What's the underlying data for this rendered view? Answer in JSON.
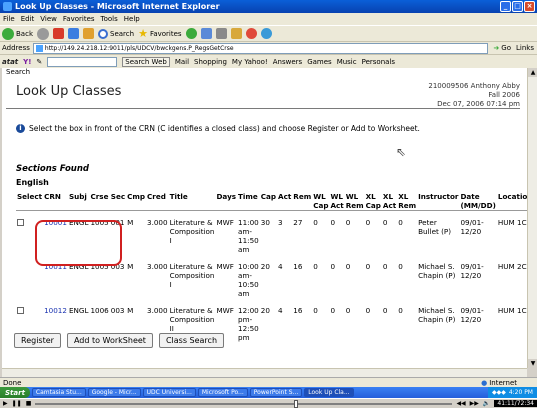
{
  "window": {
    "title": "Look Up Classes - Microsoft Internet Explorer",
    "btn_min": "_",
    "btn_max": "□",
    "btn_close": "×"
  },
  "menu": [
    "File",
    "Edit",
    "View",
    "Favorites",
    "Tools",
    "Help"
  ],
  "toolbar": {
    "back": "Back",
    "search": "Search",
    "favorites": "Favorites"
  },
  "address": {
    "label": "Address",
    "url": "http://149.24.218.12:9011/pls/UDCV/bwckgens.P_RegsGetCrse",
    "go": "Go",
    "links": "Links"
  },
  "linkbar": {
    "brand": "atat",
    "search_web": "Search Web",
    "items": [
      "Mail",
      "Shopping",
      "My Yahoo!",
      "Answers",
      "Games",
      "Music",
      "Personals"
    ]
  },
  "page": {
    "top_fragment": "Search",
    "heading": "Look Up Classes",
    "user": {
      "line1": "210009506 Anthony Abby",
      "term": "Fall 2006",
      "datetime": "Dec 07, 2006 07:14 pm"
    },
    "instruction": "Select the box in front of the CRN (C identifies a closed class) and choose Register or Add to Worksheet.",
    "sections_found": "Sections Found",
    "subject": "English",
    "columns": [
      "Select",
      "CRN",
      "Subj",
      "Crse",
      "Sec",
      "Cmp",
      "Cred",
      "Title",
      "Days",
      "Time",
      "Cap",
      "Act",
      "Rem",
      "WL Cap",
      "WL Act",
      "WL Rem",
      "XL Cap",
      "XL Act",
      "XL Rem",
      "Instructor",
      "Date (MM/DD)",
      "Location"
    ],
    "rows": [
      {
        "crn": "10001",
        "subj": "ENGL",
        "crse": "1005",
        "sec": "001",
        "cmp": "M",
        "cred": "3.000",
        "title": "Literature & Composition I",
        "days": "MWF",
        "time": "11:00 am-11:50 am",
        "cap": "30",
        "act": "3",
        "rem": "27",
        "wlcap": "0",
        "wlact": "0",
        "wlrem": "0",
        "xlcap": "0",
        "xlact": "0",
        "xlrem": "0",
        "instructor": "Peter Bullet (P)",
        "date": "09/01-12/20",
        "loc": "HUM 1C"
      },
      {
        "crn": "10011",
        "subj": "ENGL",
        "crse": "1005",
        "sec": "003",
        "cmp": "M",
        "cred": "3.000",
        "title": "Literature & Composition I",
        "days": "MWF",
        "time": "10:00 am-10:50 am",
        "cap": "20",
        "act": "4",
        "rem": "16",
        "wlcap": "0",
        "wlact": "0",
        "wlrem": "0",
        "xlcap": "0",
        "xlact": "0",
        "xlrem": "0",
        "instructor": "Michael S. Chapin (P)",
        "date": "09/01-12/20",
        "loc": "HUM 2C"
      },
      {
        "crn": "10012",
        "subj": "ENGL",
        "crse": "1006",
        "sec": "003",
        "cmp": "M",
        "cred": "3.000",
        "title": "Literature & Composition II",
        "days": "MWF",
        "time": "12:00 pm-12:50 pm",
        "cap": "20",
        "act": "4",
        "rem": "16",
        "wlcap": "0",
        "wlact": "0",
        "wlrem": "0",
        "xlcap": "0",
        "xlact": "0",
        "xlrem": "0",
        "instructor": "Michael S. Chapin (P)",
        "date": "09/01-12/20",
        "loc": "HUM 1C"
      }
    ],
    "buttons": {
      "register": "Register",
      "worksheet": "Add to WorkSheet",
      "search": "Class Search"
    }
  },
  "status": {
    "text": "Done",
    "zone": "Internet"
  },
  "taskbar": {
    "start": "Start",
    "tasks": [
      "Camtasia Stu...",
      "Google - Micr...",
      "UDC Universi...",
      "Microsoft Po...",
      "PowerPoint S...",
      "Look Up Cla..."
    ],
    "time": "4:20 PM"
  },
  "media": {
    "counter": "41:11/72:34"
  }
}
